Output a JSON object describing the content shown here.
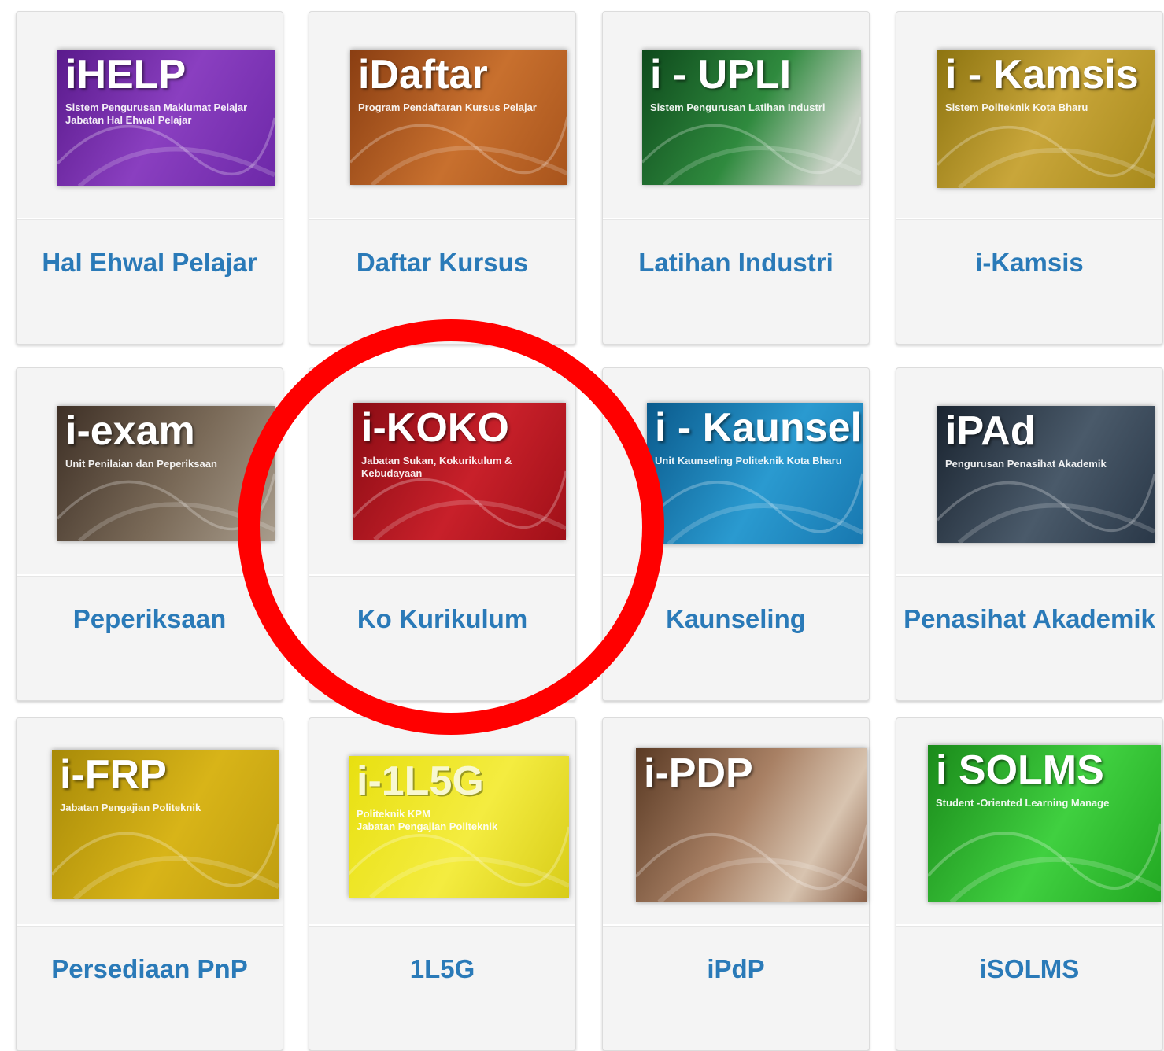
{
  "tiles": [
    {
      "label": "Hal Ehwal Pelajar",
      "logo": "iHELP",
      "sub": "Sistem Pengurusan Maklumat Pelajar\nJabatan Hal Ehwal Pelajar",
      "bg": "linear-gradient(120deg,#5a1a8c,#8a3fc0 50%,#6d28a8)"
    },
    {
      "label": "Daftar Kursus",
      "logo": "iDaftar",
      "sub": "Program Pendaftaran Kursus Pelajar",
      "bg": "linear-gradient(120deg,#8a3e12,#c8702e 55%,#a8541c)"
    },
    {
      "label": "Latihan Industri",
      "logo": "i - UPLI",
      "sub": "Sistem Pengurusan Latihan Industri",
      "bg": "linear-gradient(120deg,#0e4a1c,#2f8a3e 50%,#c9d2c6 85%)"
    },
    {
      "label": "i-Kamsis",
      "logo": "i - Kamsis",
      "sub": "Sistem Politeknik Kota Bharu",
      "bg": "linear-gradient(120deg,#8d7410,#c9a63a 50%,#a88a1c)"
    },
    {
      "label": "Peperiksaan",
      "logo": "i-exam",
      "sub": "Unit Penilaian dan Peperiksaan",
      "bg": "linear-gradient(120deg,#3e3026,#7a6a58 55%,#a89c8c)"
    },
    {
      "label": "Ko Kurikulum",
      "logo": "i-KOKO",
      "sub": "Jabatan Sukan, Kokurikulum & Kebudayaan",
      "bg": "linear-gradient(120deg,#8a0c14,#c8202a 55%,#a01018)"
    },
    {
      "label": "Kaunseling",
      "logo": "i - Kaunselor",
      "sub": "Unit Kaunseling Politeknik Kota Bharu",
      "bg": "linear-gradient(120deg,#0a5a8c,#2a9ad0 55%,#1878b0)"
    },
    {
      "label": "Penasihat Akademik",
      "logo": "iPAd",
      "sub": "Pengurusan Penasihat Akademik",
      "bg": "linear-gradient(120deg,#1a2430,#4a5a6a 55%,#2a3848)"
    },
    {
      "label": "Persediaan PnP",
      "logo": "i-FRP",
      "sub": "Jabatan Pengajian Politeknik",
      "bg": "linear-gradient(120deg,#a88a08,#d8b418 55%,#c09e10)"
    },
    {
      "label": "1L5G",
      "logo": "i-1L5G",
      "sub": "Politeknik KPM\nJabatan Pengajian Politeknik",
      "bg": "linear-gradient(120deg,#e8e010,#f4ec40 55%,#d8cc18)"
    },
    {
      "label": "iPdP",
      "logo": "i-PDP",
      "sub": "",
      "bg": "linear-gradient(120deg,#5a3a24,#a88064 45%,#d8c4b0 75%,#8a6048)"
    },
    {
      "label": "iSOLMS",
      "logo": "i SOLMS",
      "sub": "Student -Oriented Learning Manage",
      "bg": "linear-gradient(120deg,#1a8a1a,#40d040 55%,#22a822)"
    }
  ]
}
